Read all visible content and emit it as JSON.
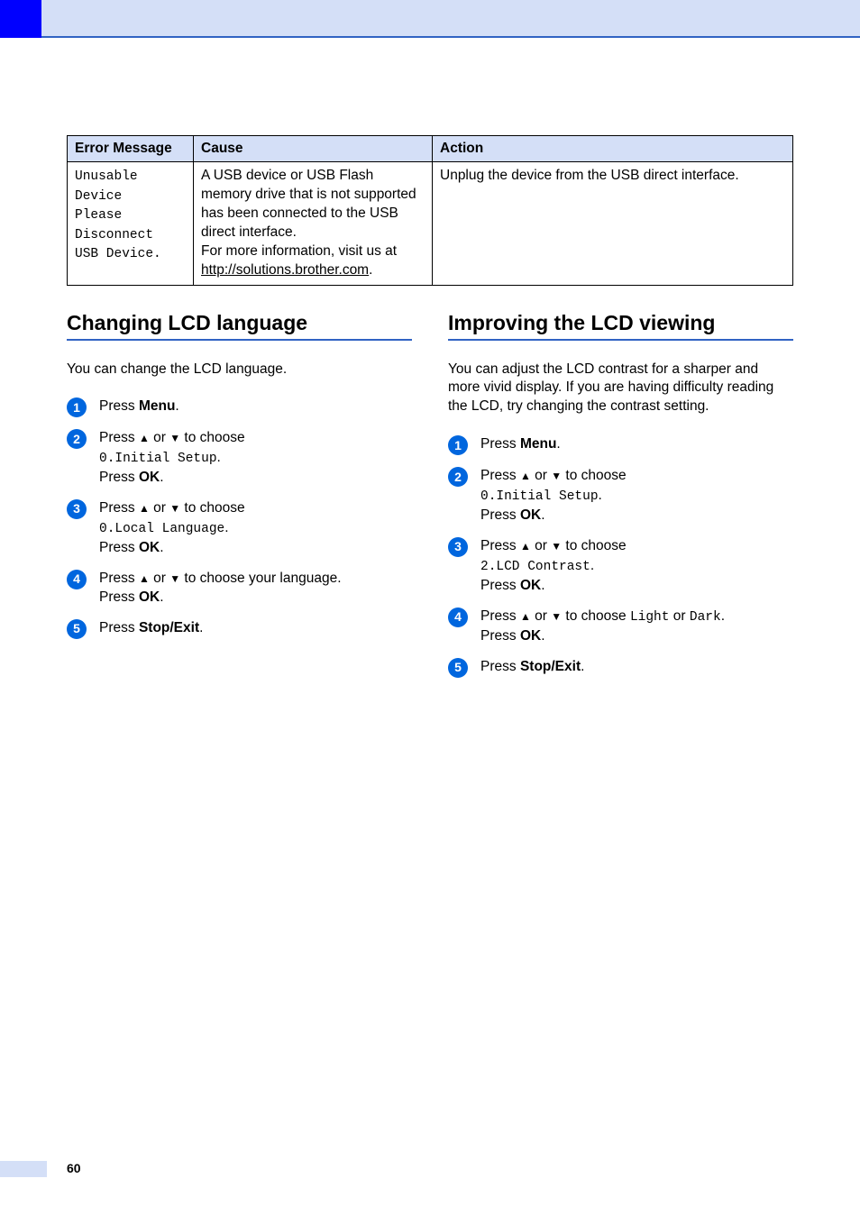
{
  "table": {
    "headers": [
      "Error Message",
      "Cause",
      "Action"
    ],
    "row": {
      "error_line1": "Unusable Device",
      "error_line2": "Please Disconnect",
      "error_line3": "USB Device.",
      "cause_part1": "A USB device or USB Flash memory drive that is not supported has been connected to the USB direct interface.",
      "cause_part2": "For more information, visit us at ",
      "cause_link": "http://solutions.brother.com",
      "cause_period": ".",
      "action": "Unplug the device from the USB direct interface."
    }
  },
  "left": {
    "heading": "Changing LCD language",
    "intro": "You can change the LCD language.",
    "steps": {
      "s1": {
        "press": "Press ",
        "menu": "Menu",
        "dot": "."
      },
      "s2": {
        "a": "Press ",
        "up": "▲",
        "or": " or ",
        "down": "▼",
        "b": " to choose ",
        "code": "0.Initial Setup",
        "dot": ".",
        "press": "Press ",
        "ok": "OK",
        "dot2": "."
      },
      "s3": {
        "a": "Press ",
        "up": "▲",
        "or": " or ",
        "down": "▼",
        "b": " to choose ",
        "code": "0.Local Language",
        "dot": ".",
        "press": "Press ",
        "ok": "OK",
        "dot2": "."
      },
      "s4": {
        "a": "Press ",
        "up": "▲",
        "or": " or ",
        "down": "▼",
        "b": " to choose your language.",
        "press": "Press ",
        "ok": "OK",
        "dot2": "."
      },
      "s5": {
        "press": "Press ",
        "stop": "Stop/Exit",
        "dot": "."
      }
    }
  },
  "right": {
    "heading": "Improving the LCD viewing",
    "intro": "You can adjust the LCD contrast for a sharper and more vivid display. If you are having difficulty reading the LCD, try changing the contrast setting.",
    "steps": {
      "s1": {
        "press": "Press ",
        "menu": "Menu",
        "dot": "."
      },
      "s2": {
        "a": "Press ",
        "up": "▲",
        "or": " or ",
        "down": "▼",
        "b": " to choose ",
        "code": "0.Initial Setup",
        "dot": ".",
        "press": "Press ",
        "ok": "OK",
        "dot2": "."
      },
      "s3": {
        "a": "Press ",
        "up": "▲",
        "or": " or ",
        "down": "▼",
        "b": " to choose ",
        "code": "2.LCD Contrast",
        "dot": ".",
        "press": "Press ",
        "ok": "OK",
        "dot2": "."
      },
      "s4": {
        "a": "Press ",
        "up": "▲",
        "or": " or ",
        "down": "▼",
        "b": " to choose ",
        "light": "Light",
        "or2": " or ",
        "dark": "Dark",
        "dot": ".",
        "press": "Press ",
        "ok": "OK",
        "dot2": "."
      },
      "s5": {
        "press": "Press ",
        "stop": "Stop/Exit",
        "dot": "."
      }
    }
  },
  "page_number": "60"
}
